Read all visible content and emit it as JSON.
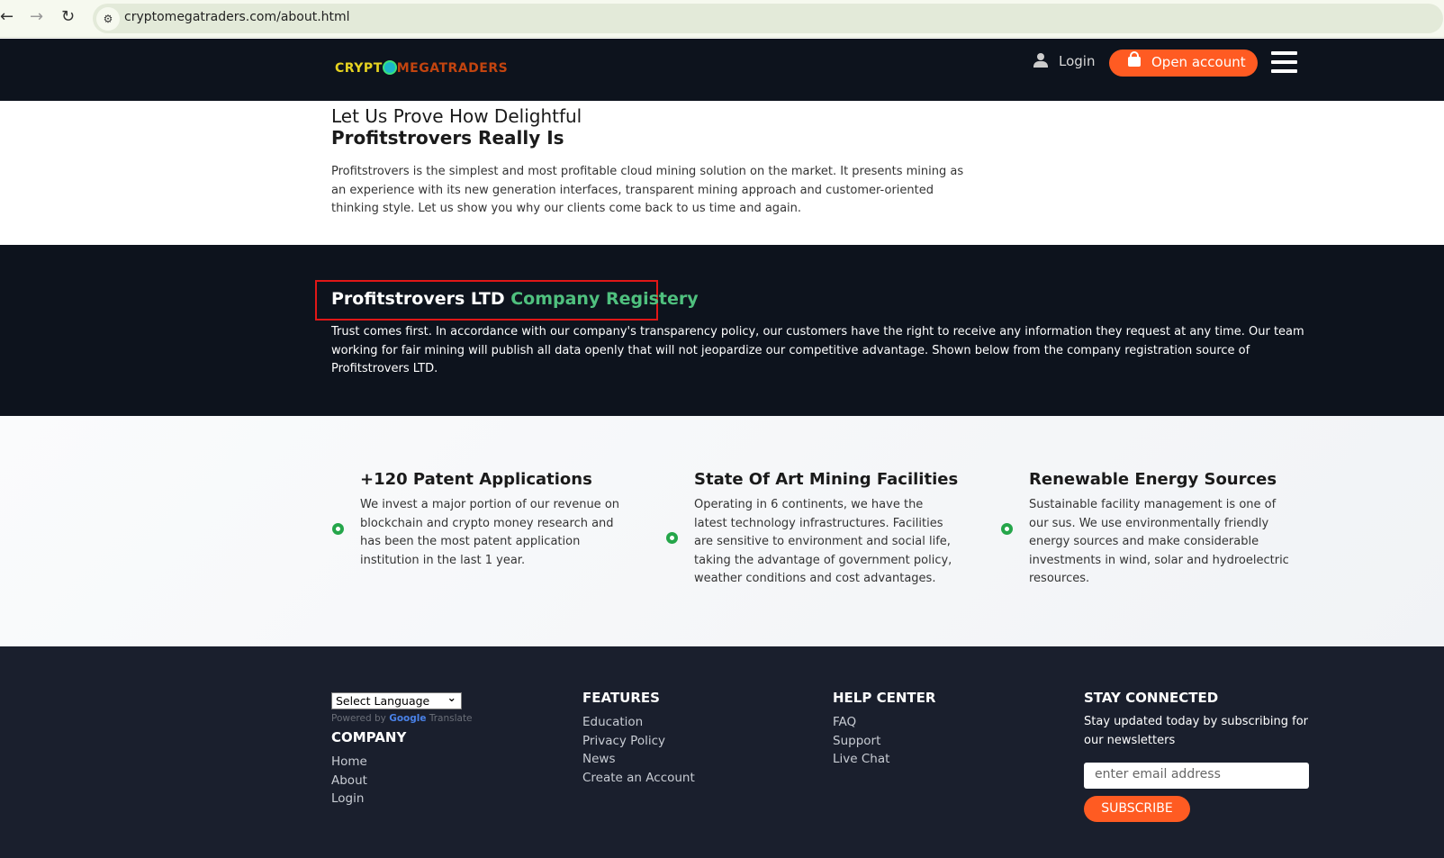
{
  "browser": {
    "url": "cryptomegatraders.com/about.html"
  },
  "header": {
    "logo_left": "CRYPT",
    "logo_right": "MEGATRADERS",
    "login": "Login",
    "open_account": "Open account"
  },
  "intro": {
    "title_line1": "Let Us Prove How Delightful",
    "title_line2": "Profitstrovers Really Is",
    "text": "Profitstrovers is the simplest and most profitable cloud mining solution on the market. It presents mining as an experience with its new generation interfaces, transparent mining approach and customer-oriented thinking style. Let us show you why our clients come back to us time and again."
  },
  "registry": {
    "title_white": "Profitstrovers LTD",
    "title_green": "Company Registery",
    "text": "Trust comes first. In accordance with our company's transparency policy, our customers have the right to receive any information they request at any time. Our team working for fair mining will publish all data openly that will not jeopardize our competitive advantage. Shown below from the company registration source of Profitstrovers LTD."
  },
  "features": [
    {
      "title": "+120 Patent Applications",
      "text": "We invest a major portion of our revenue on blockchain and crypto money research and has been the most patent application institution in the last 1 year."
    },
    {
      "title": "State Of Art Mining Facilities",
      "text": "Operating in 6 continents, we have the latest technology infrastructures. Facilities are sensitive to environment and social life, taking the advantage of government policy, weather conditions and cost advantages."
    },
    {
      "title": "Renewable Energy Sources",
      "text": "Sustainable facility management is one of our sus. We use environmentally friendly energy sources and make considerable investments in wind, solar and hydroelectric resources."
    }
  ],
  "footer": {
    "language_select": "Select Language",
    "powered_by": "Powered by",
    "google": "Google",
    "translate": "Translate",
    "company": {
      "title": "COMPANY",
      "links": [
        "Home",
        "About",
        "Login"
      ]
    },
    "features": {
      "title": "FEATURES",
      "links": [
        "Education",
        "Privacy Policy",
        "News",
        "Create an Account"
      ]
    },
    "help": {
      "title": "HELP CENTER",
      "links": [
        "FAQ",
        "Support",
        "Live Chat"
      ]
    },
    "stay": {
      "title": "STAY CONNECTED",
      "text": "Stay updated today by subscribing for our newsletters",
      "email_placeholder": "enter email address",
      "subscribe": "SUBSCRIBE"
    }
  }
}
